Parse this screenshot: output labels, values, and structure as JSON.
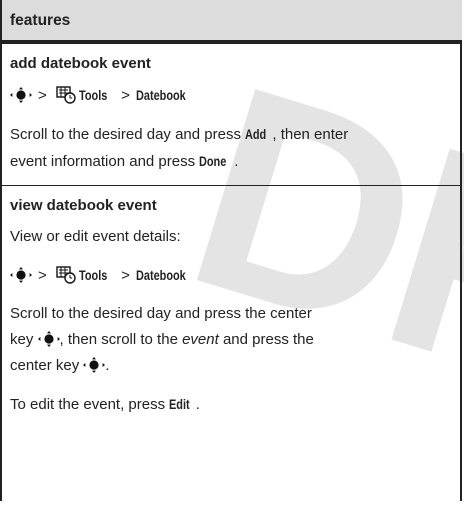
{
  "watermark": "DRA",
  "header": {
    "title": "features"
  },
  "sections": [
    {
      "title": "add datebook event",
      "path": {
        "tools": "Tools",
        "sep": ">",
        "datebook": "Datebook"
      },
      "body": {
        "t1": "Scroll to the desired day and press ",
        "b1": "Add",
        "t2": ", then enter",
        "t3": "event information and press ",
        "b2": "Done",
        "t4": "."
      }
    },
    {
      "title": "view datebook event",
      "intro": "View or edit event details:",
      "path": {
        "tools": "Tools",
        "sep": ">",
        "datebook": "Datebook"
      },
      "body": {
        "t1": "Scroll to the desired day and press the center",
        "t2": "key ",
        "t3": ", then scroll to the ",
        "i1": "event",
        "t4": " and press the",
        "t5": "center key ",
        "t6": "."
      },
      "edit": {
        "t1": "To edit the event, press ",
        "b1": "Edit",
        "t2": "."
      }
    }
  ]
}
